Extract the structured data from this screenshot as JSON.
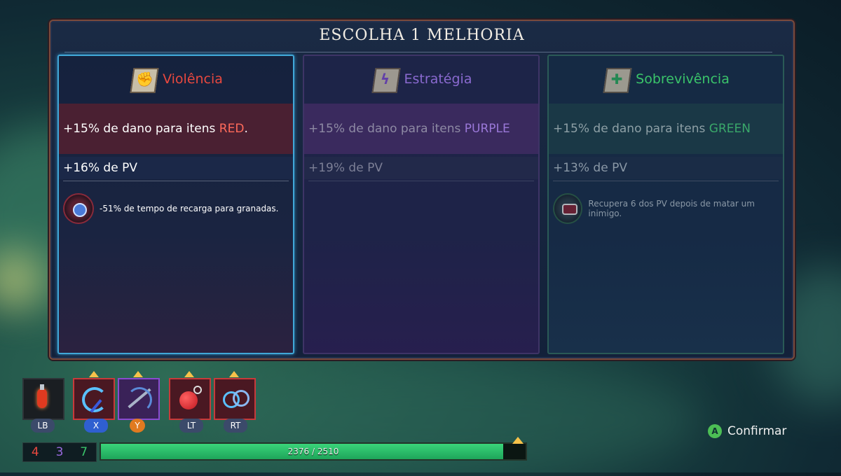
{
  "dialog": {
    "title": "ESCOLHA 1 MELHORIA"
  },
  "cards": [
    {
      "name": "Violência",
      "color": "#e8483f",
      "icon": "fist-scroll-icon",
      "stat1_prefix": "+15% de dano para itens ",
      "stat1_color_word": "RED",
      "stat1_suffix": ".",
      "stat2": "+16% de PV",
      "bonus": "-51% de tempo de recarga para granadas.",
      "bonus_icon": "grenade-cooldown-icon",
      "selected": true
    },
    {
      "name": "Estratégia",
      "color": "#8a6ad0",
      "icon": "lightning-scroll-icon",
      "stat1_prefix": "+15% de dano para itens ",
      "stat1_color_word": "PURPLE",
      "stat1_suffix": "",
      "stat2": "+19% de PV",
      "bonus": "",
      "selected": false
    },
    {
      "name": "Sobrevivência",
      "color": "#3ac46a",
      "icon": "cross-scroll-icon",
      "stat1_prefix": "+15% de dano para itens ",
      "stat1_color_word": "GREEN",
      "stat1_suffix": "",
      "stat2": "+13% de PV",
      "bonus": "Recupera 6 dos PV depois de matar um inimigo.",
      "bonus_icon": "monster-mouth-icon",
      "selected": false
    }
  ],
  "hud": {
    "slots": [
      {
        "key": "LB",
        "icon": "potion-icon",
        "badge_color": "#3b4a6a",
        "upgrade": false
      },
      {
        "key": "X",
        "icon": "whip-icon",
        "badge_color": "#2f5fd0",
        "upgrade": true
      },
      {
        "key": "Y",
        "icon": "crossbow-icon",
        "badge_color": "#e07a20",
        "upgrade": true
      },
      {
        "key": "LT",
        "icon": "bomb-icon",
        "badge_color": "#3b4a6a",
        "upgrade": true
      },
      {
        "key": "RT",
        "icon": "ring-icon",
        "badge_color": "#3b4a6a",
        "upgrade": true
      }
    ],
    "scrolls": {
      "red": "4",
      "purple": "3",
      "green": "7"
    },
    "xp": {
      "text": "2376 / 2510",
      "fraction": 0.9466
    },
    "confirm_button": "A",
    "confirm_label": "Confirmar"
  }
}
